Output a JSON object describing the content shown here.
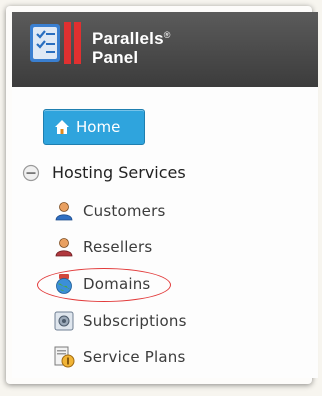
{
  "header": {
    "brand_line1": "Parallels",
    "brand_mark": "®",
    "brand_line2": "Panel",
    "logo_icon": "parallels-logo-icon"
  },
  "nav": {
    "home": {
      "label": "Home",
      "icon": "home-icon"
    },
    "section": {
      "label": "Hosting Services",
      "icon": "collapse-icon"
    },
    "items": [
      {
        "label": "Customers",
        "icon": "customer-icon"
      },
      {
        "label": "Resellers",
        "icon": "reseller-icon"
      },
      {
        "label": "Domains",
        "icon": "globe-icon",
        "highlighted": true
      },
      {
        "label": "Subscriptions",
        "icon": "subscription-icon"
      },
      {
        "label": "Service Plans",
        "icon": "service-plan-icon"
      }
    ]
  },
  "colors": {
    "header_bg": "#4a4a4a",
    "home_button": "#2fa4dd",
    "highlight": "#e23b3b"
  }
}
